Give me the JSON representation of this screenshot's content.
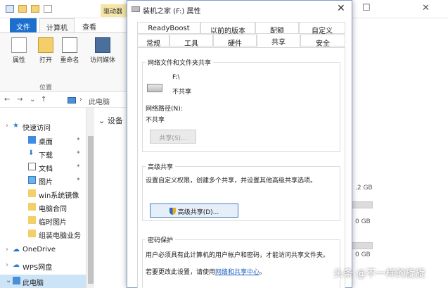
{
  "explorer": {
    "context_tab": "驱动器",
    "ribbon_tabs": [
      "文件",
      "计算机",
      "查看"
    ],
    "ribbon_buttons": [
      "属性",
      "打开",
      "重命名",
      "访问媒体"
    ],
    "ribbon_group": "位置",
    "address": "此电脑",
    "devices_heading": "设备",
    "nav": {
      "quick_access": "快速访问",
      "items": [
        "桌面",
        "下载",
        "文档",
        "图片",
        "win系统镜像",
        "电脑合同",
        "临时图片",
        "组装电脑业务"
      ],
      "onedrive": "OneDrive",
      "wps": "WPS网盘",
      "this_pc": "此电脑"
    },
    "drive_sizes": [
      ".2 GB",
      "0 GB",
      "0 GB"
    ]
  },
  "dialog": {
    "title": "装机之家 (F:) 属性",
    "tabs_row1": [
      "ReadyBoost",
      "以前的版本",
      "配额",
      "自定义"
    ],
    "tabs_row2": [
      "常规",
      "工具",
      "硬件",
      "共享",
      "安全"
    ],
    "active_tab": "共享",
    "network_share": {
      "title": "网络文件和文件夹共享",
      "drive_name": "F:\\",
      "drive_status": "不共享",
      "path_label": "网络路径(N):",
      "path_value": "不共享",
      "share_button": "共享(S)..."
    },
    "advanced_share": {
      "title": "高级共享",
      "description": "设置自定义权限，创建多个共享，并设置其他高级共享选项。",
      "button": "高级共享(D)..."
    },
    "password": {
      "title": "密码保护",
      "line1": "用户必须具有此计算机的用户帐户和密码，才能访问共享文件夹。",
      "line2_prefix": "若要更改此设置，请使用",
      "line2_link": "网络和共享中心",
      "line2_suffix": "。"
    }
  },
  "watermark": "头条 @不一样的旋旋"
}
